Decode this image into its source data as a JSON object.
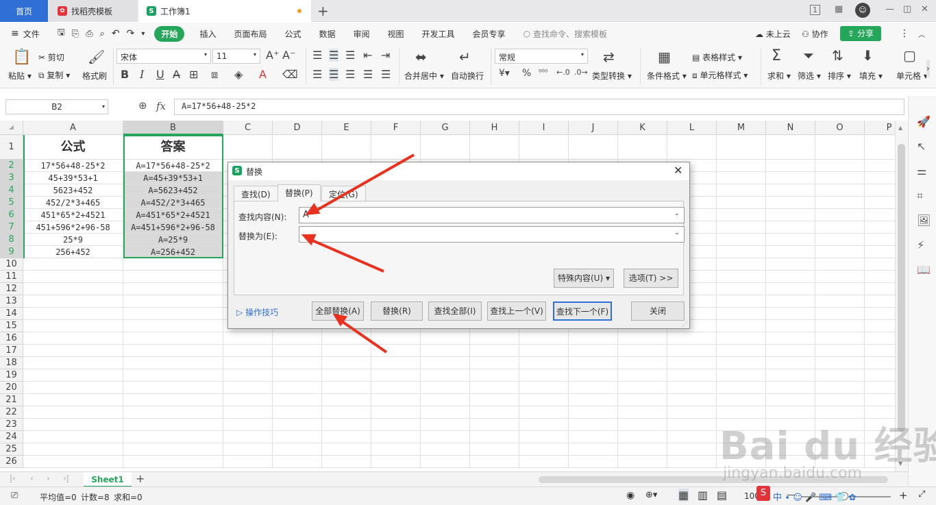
{
  "tabs": {
    "home": "首页",
    "template": "找稻壳模板",
    "workbook": "工作簿1"
  },
  "window": {
    "page_ind": "1",
    "restore": "◫",
    "minimize": "—",
    "maximize": "▢",
    "close": "✕"
  },
  "menu": {
    "file": "文件",
    "start": "开始",
    "insert": "插入",
    "layout": "页面布局",
    "formula": "公式",
    "data": "数据",
    "review": "审阅",
    "view": "视图",
    "dev": "开发工具",
    "vip": "会员专享",
    "search": "查找命令、搜索模板",
    "cloud": "未上云",
    "collab": "协作",
    "share": "分享"
  },
  "ribbon": {
    "paste": "粘贴",
    "cut": "剪切",
    "copy": "复制",
    "painter": "格式刷",
    "font": "宋体",
    "size": "11",
    "merge": "合并居中",
    "wrap": "自动换行",
    "numfmt": "常规",
    "convert": "类型转换",
    "cond": "条件格式",
    "tablestyle": "表格样式",
    "cellstyle": "单元格样式",
    "sum": "求和",
    "filter": "筛选",
    "sort": "排序",
    "fill": "填充",
    "cell": "单元格",
    "pct": "%",
    "bold": "B",
    "italic": "I",
    "underline": "U"
  },
  "formulabar": {
    "namebox": "B2",
    "fx": "fx",
    "value": "A=17*56+48-25*2"
  },
  "columns": [
    "A",
    "B",
    "C",
    "D",
    "E",
    "F",
    "G",
    "H",
    "I",
    "J",
    "K",
    "L",
    "M",
    "N",
    "O",
    "P"
  ],
  "rows": [
    "1",
    "2",
    "3",
    "4",
    "5",
    "6",
    "7",
    "8",
    "9",
    "10",
    "11",
    "12",
    "13",
    "14",
    "15",
    "16",
    "17",
    "18",
    "19",
    "20",
    "21",
    "22",
    "23",
    "24",
    "25",
    "26"
  ],
  "cells": {
    "A1": "公式",
    "B1": "答案",
    "A2": "17*56+48-25*2",
    "B2": "A=17*56+48-25*2",
    "A3": "45+39*53+1",
    "B3": "A=45+39*53+1",
    "A4": "5623+452",
    "B4": "A=5623+452",
    "A5": "452/2*3+465",
    "B5": "A=452/2*3+465",
    "A6": "451*65*2+4521",
    "B6": "A=451*65*2+4521",
    "A7": "451+596*2+96-58",
    "B7": "A=451+596*2+96-58",
    "A8": "25*9",
    "B8": "A=25*9",
    "A9": "256+452",
    "B9": "A=256+452"
  },
  "sheet": {
    "name": "Sheet1"
  },
  "status": {
    "avg": "平均值=0",
    "count": "计数=8",
    "sum": "求和=0",
    "zoom": "100%"
  },
  "dialog": {
    "title": "替换",
    "tab_find": "查找(D)",
    "tab_replace": "替换(P)",
    "tab_goto": "定位(G)",
    "find_label": "查找内容(N):",
    "find_value": "A",
    "replace_label": "替换为(E):",
    "replace_value": "",
    "special": "特殊内容(U) ▾",
    "options": "选项(T) >>",
    "tips": "操作技巧",
    "replace_all": "全部替换(A)",
    "replace": "替换(R)",
    "find_all": "查找全部(I)",
    "find_prev": "查找上一个(V)",
    "find_next": "查找下一个(F)",
    "close": "关闭"
  },
  "watermark": "Bai du 经验",
  "watermark_url": "jingyan.baidu.com",
  "colors": {
    "accent": "#26a65b",
    "selection": "#d9d9d9",
    "arrow": "#e8321f",
    "tab_home": "#2f6fd6"
  }
}
